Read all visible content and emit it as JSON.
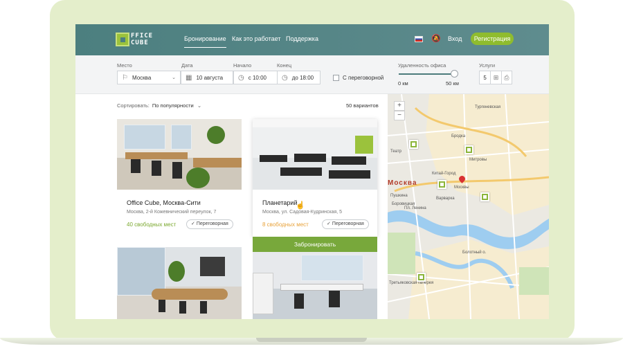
{
  "header": {
    "logo_line1": "FFICE",
    "logo_line2": "CUBE",
    "nav": [
      "Бронирование",
      "Как это работает",
      "Поддержка"
    ],
    "login": "Вход",
    "register": "Регистрация"
  },
  "filters": {
    "place_label": "Место",
    "place_value": "Москва",
    "date_label": "Дата",
    "date_value": "10 августа",
    "start_label": "Начало",
    "start_value": "с 10:00",
    "end_label": "Конец",
    "end_value": "до 18:00",
    "meeting_label": "С переговорной",
    "distance_label": "Удаленность офиса",
    "distance_min": "0 км",
    "distance_max": "50 км",
    "distance_value": 50,
    "services_label": "Услуги",
    "services_count": "5"
  },
  "list": {
    "sort_label": "Сортировать:",
    "sort_value": "По популярности",
    "results": "50 вариантов"
  },
  "cards": [
    {
      "title": "Office Cube, Москва-Сити",
      "address": "Москва, 2-й Кожевнический переулок, 7",
      "seats": "40 свободных мест",
      "badge": "Переговорная"
    },
    {
      "title": "Планетарий",
      "address": "Москва, ул. Садовая-Кудринская, 5",
      "seats": "8 свободных мест",
      "badge": "Переговорная",
      "book": "Забронировать"
    }
  ],
  "map": {
    "zoom_in": "+",
    "zoom_out": "−",
    "city": "Москва",
    "labels": [
      "Тургеневская",
      "Театр",
      "Митровы",
      "Бродка",
      "Китай-Город",
      "Москвы",
      "Пушкина",
      "Боровицкая",
      "Варварка",
      "Пл. Ленина",
      "Болотный о.",
      "Третьяковская галерея"
    ]
  },
  "colors": {
    "header_bg": "#4c7f7f",
    "accent_green": "#8fbc2e",
    "book_green": "#78a83b",
    "seats_green": "#7ba82f",
    "seats_orange": "#e8a23a"
  }
}
